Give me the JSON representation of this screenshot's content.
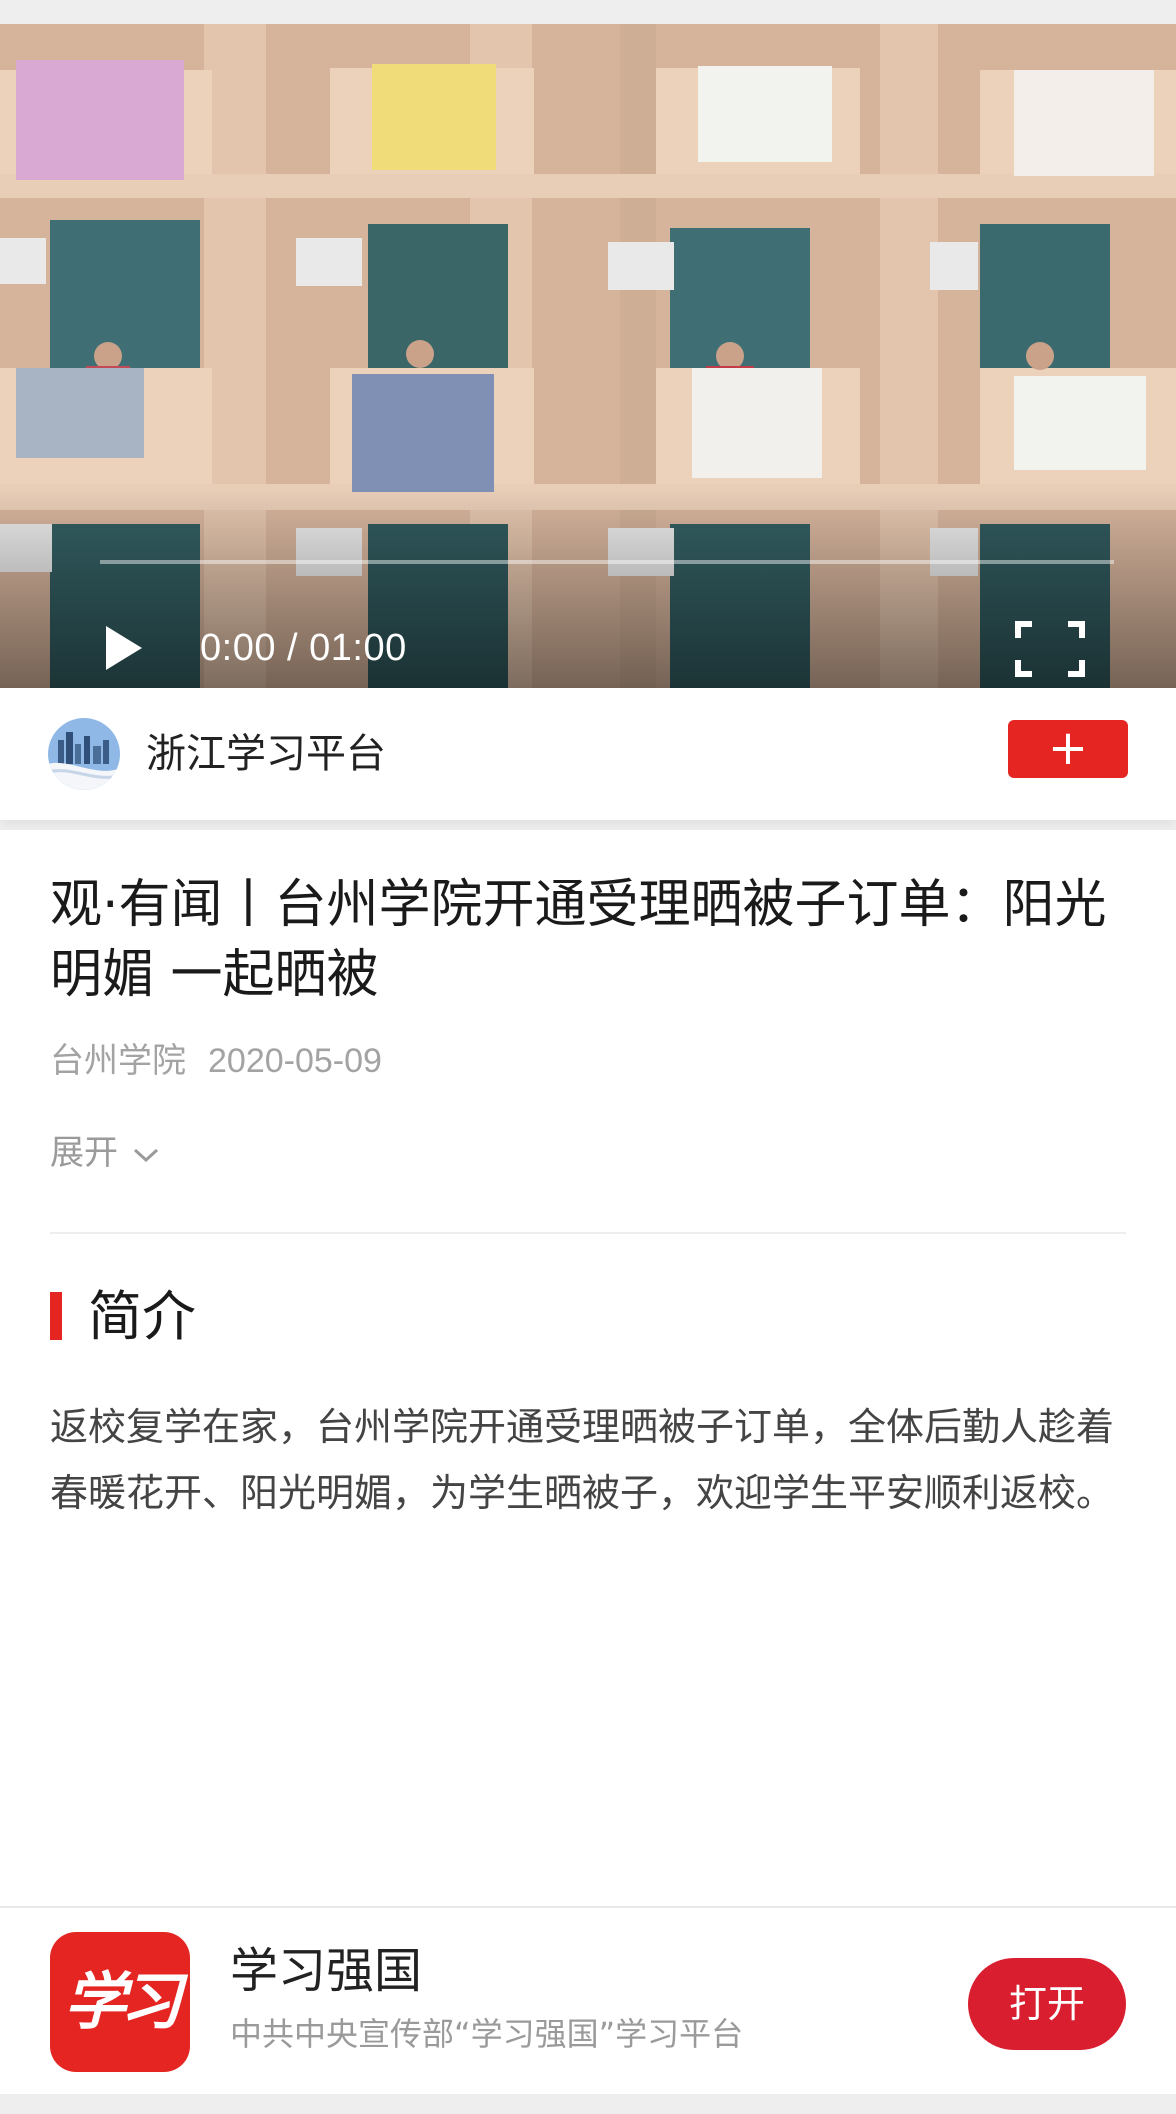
{
  "video": {
    "current_time": "0:00",
    "duration": "01:00",
    "time_display": "0:00 / 01:00",
    "progress": 0,
    "play_icon": "play-icon",
    "fullscreen_icon": "fullscreen-icon"
  },
  "account": {
    "name": "浙江学习平台",
    "follow_icon": "plus-icon",
    "follow_symbol": "+"
  },
  "article": {
    "title": "观·有闻丨台州学院开通受理晒被子订单：阳光明媚 一起晒被",
    "source": "台州学院",
    "date": "2020-05-09",
    "expand_label": "展开",
    "section_title": "简介",
    "intro": "返校复学在家，台州学院开通受理晒被子订单，全体后勤人趁着春暖花开、阳光明媚，为学生晒被子，欢迎学生平安顺利返校。"
  },
  "app_promo": {
    "icon_text": "学习",
    "name": "学习强国",
    "description": "中共中央宣传部“学习强国”学习平台",
    "open_label": "打开"
  },
  "colors": {
    "accent": "#e52521",
    "open_button": "#d81e2f",
    "meta_text": "#a3a3a3"
  }
}
